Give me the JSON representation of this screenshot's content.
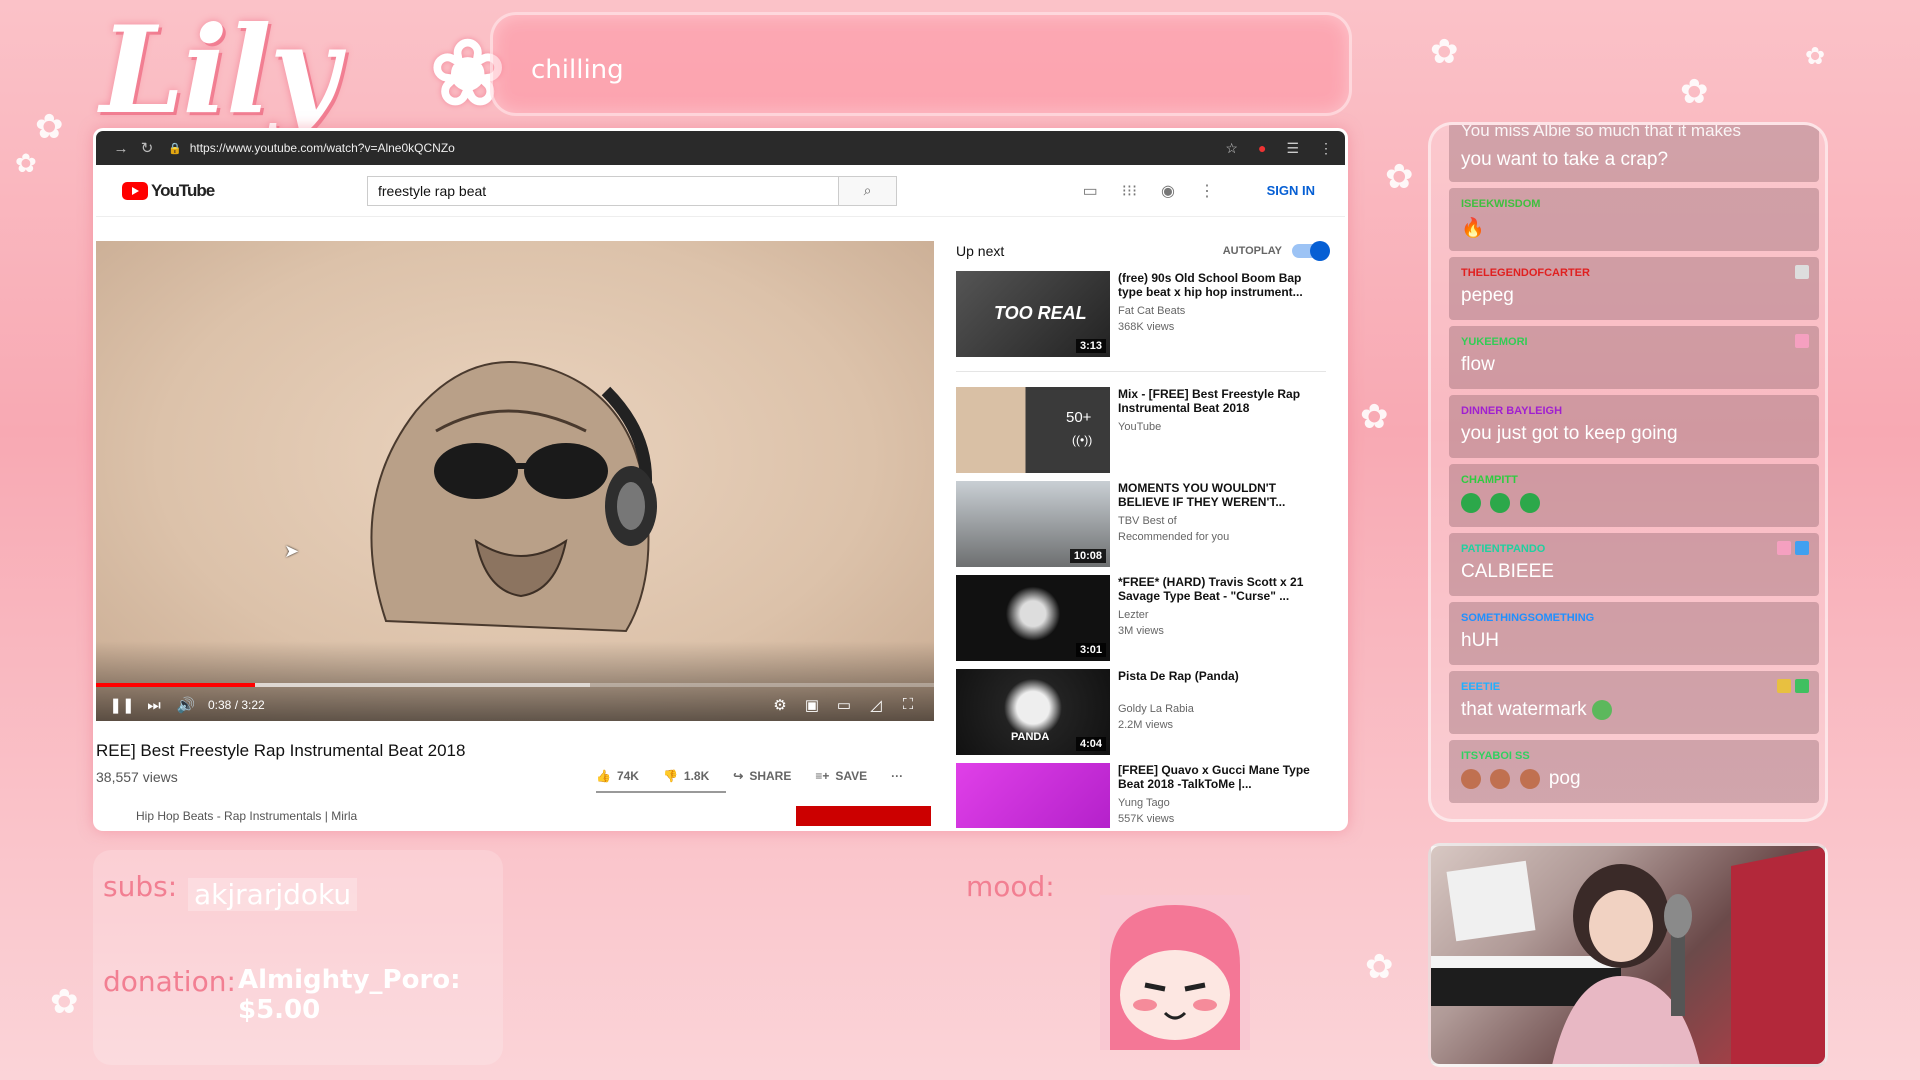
{
  "overlay": {
    "logo_text": "Lily",
    "status_text": "chilling",
    "subs_label": "subs:",
    "subs_value": "akjrarjdoku",
    "donation_label": "donation:",
    "donation_value": "Almighty_Poro: $5.00",
    "mood_label": "mood:"
  },
  "browser": {
    "url": "https://www.youtube.com/watch?v=Alne0kQCNZo"
  },
  "youtube": {
    "logo_text": "YouTube",
    "search_value": "freestyle rap beat",
    "sign_in": "SIGN IN",
    "player": {
      "time": "0:38 / 3:22",
      "progress": 0.19,
      "buffered": 0.59
    },
    "video_title": "REE] Best Freestyle Rap Instrumental Beat 2018",
    "views": "38,557 views",
    "likes": "74K",
    "dislikes": "1.8K",
    "share": "SHARE",
    "save": "SAVE",
    "channel": "Hip Hop Beats - Rap Instrumentals | Mirla"
  },
  "up_next": {
    "label": "Up next",
    "autoplay_label": "AUTOPLAY",
    "autoplay_on": true,
    "items": [
      {
        "title": "(free) 90s Old School Boom Bap type beat x hip hop instrument...",
        "channel": "Fat Cat Beats",
        "meta": "368K views",
        "duration": "3:13",
        "thumb_text": "TOO REAL"
      },
      {
        "title": "Mix - [FREE] Best Freestyle Rap Instrumental Beat 2018",
        "channel": "YouTube",
        "meta": "",
        "duration": "",
        "thumb_text": "50+"
      },
      {
        "title": "MOMENTS YOU WOULDN'T BELIEVE IF THEY WEREN'T...",
        "channel": "TBV Best of",
        "meta": "Recommended for you",
        "duration": "10:08",
        "thumb_text": ""
      },
      {
        "title": "*FREE* (HARD) Travis Scott x 21 Savage Type Beat - \"Curse\" ...",
        "channel": "Lezter",
        "meta": "3M views",
        "duration": "3:01",
        "thumb_text": ""
      },
      {
        "title": "Pista De Rap (Panda)",
        "channel": "Goldy La Rabia",
        "meta": "2.2M views",
        "duration": "4:04",
        "thumb_text": "PANDA"
      },
      {
        "title": "[FREE] Quavo x Gucci Mane Type Beat 2018 -TalkToMe |...",
        "channel": "Yung Tago",
        "meta": "557K views",
        "duration": "",
        "thumb_text": ""
      }
    ]
  },
  "chat": {
    "messages": [
      {
        "user": "",
        "text": "you want to take a crap?",
        "color": "#ffffff",
        "partial_top": "You miss Albie so much that it makes"
      },
      {
        "user": "ISEEKWISDOM",
        "text": "🔥",
        "color": "#3fbf3f"
      },
      {
        "user": "THELEGENDOFCARTER",
        "text": "pepeg",
        "color": "#e02020"
      },
      {
        "user": "YUKEEMORI",
        "text": "flow",
        "color": "#33cc55"
      },
      {
        "user": "DINNER BAYLEIGH",
        "text": "you just got to keep going",
        "color": "#a020d0"
      },
      {
        "user": "CHAMPITT",
        "text": "",
        "color": "#2ecc40"
      },
      {
        "user": "PATIENTPANDO",
        "text": "CALBIEEE",
        "color": "#20d0a0"
      },
      {
        "user": "SOMETHINGSOMETHING",
        "text": "hUH",
        "color": "#2090ff"
      },
      {
        "user": "EEETIE",
        "text": "that watermark",
        "color": "#20b0ff"
      },
      {
        "user": "ITSYABOI SS",
        "text": "pog",
        "color": "#30d060"
      }
    ]
  },
  "colors": {
    "yt_red": "#ff0000",
    "yt_blue": "#065fd4",
    "overlay_pink": "#f27f92"
  }
}
